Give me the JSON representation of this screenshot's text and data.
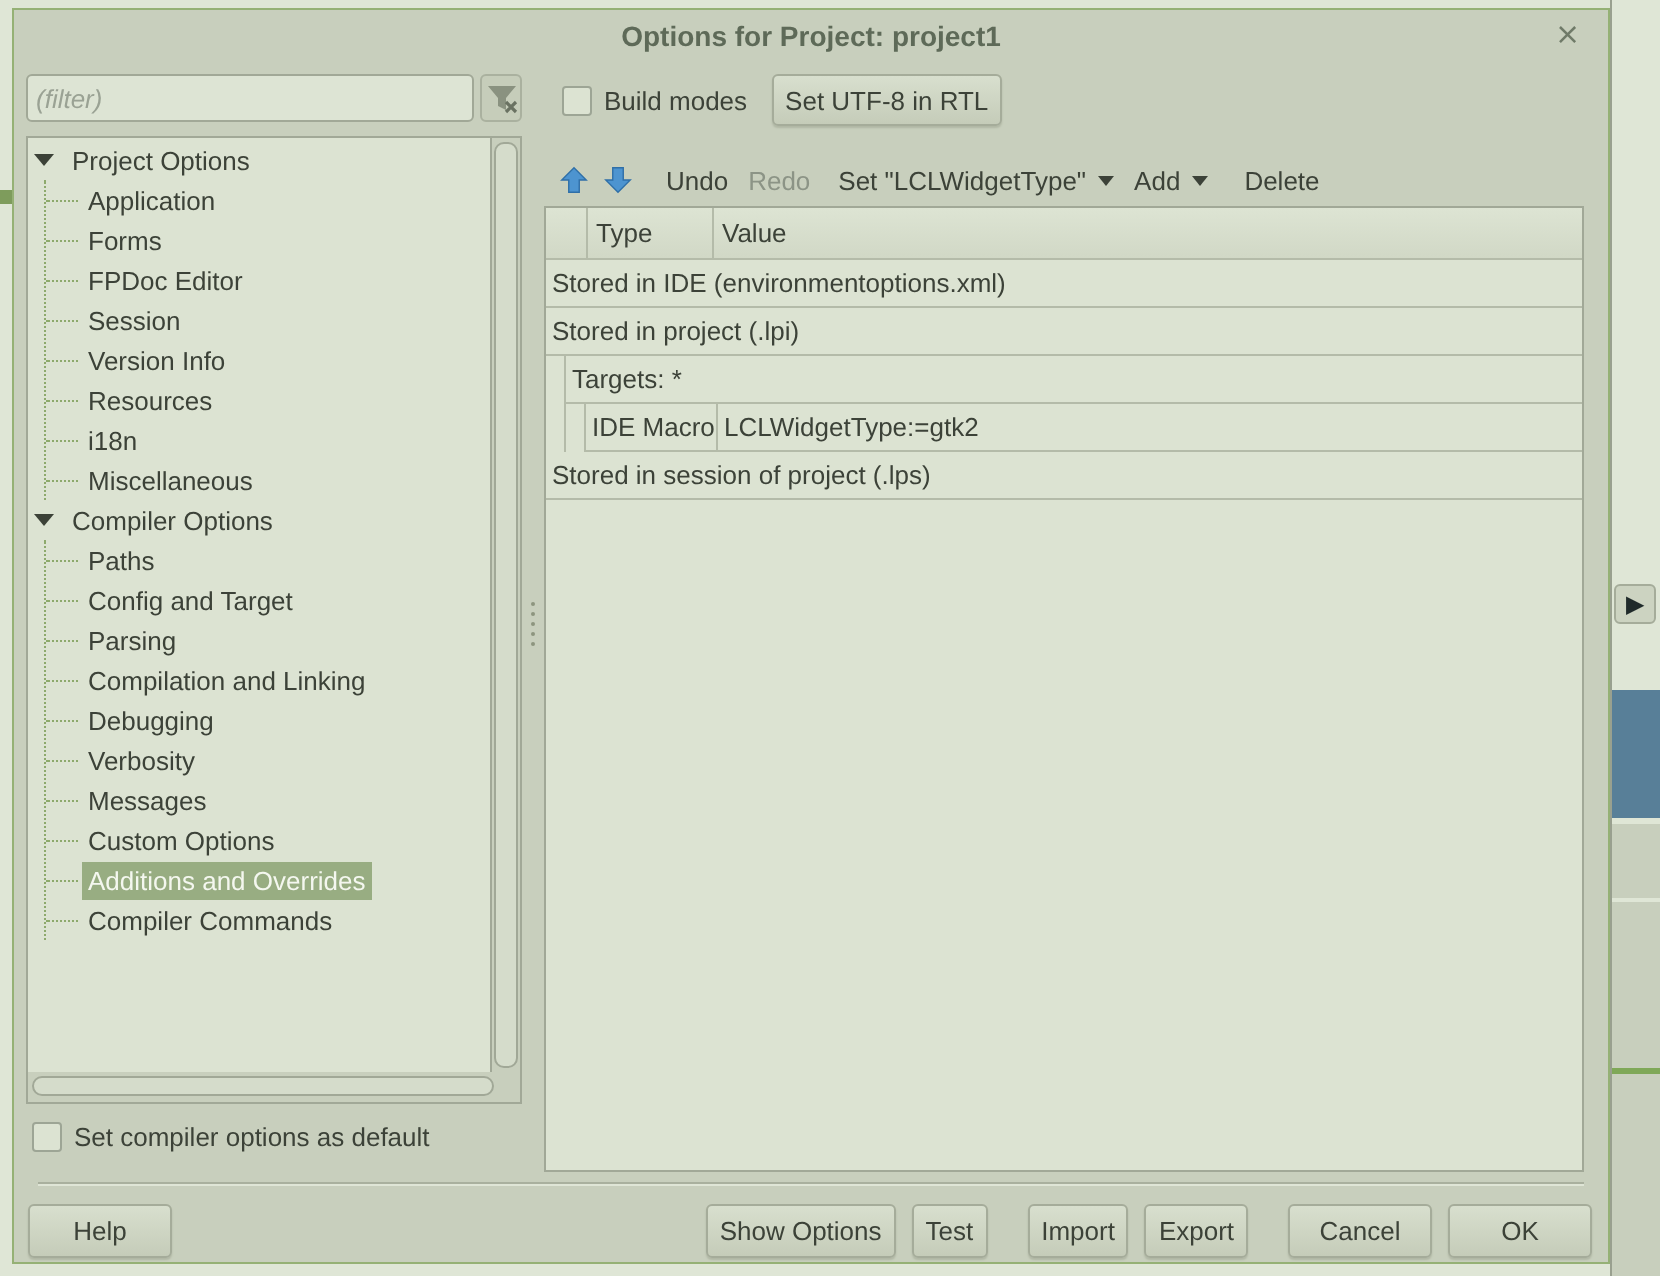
{
  "window": {
    "title": "Options for Project: project1",
    "close": "×"
  },
  "filter": {
    "placeholder": "(filter)"
  },
  "tree": [
    {
      "label": "Project Options",
      "expanded": true,
      "selected": false,
      "children": [
        {
          "label": "Application",
          "selected": false
        },
        {
          "label": "Forms",
          "selected": false
        },
        {
          "label": "FPDoc Editor",
          "selected": false
        },
        {
          "label": "Session",
          "selected": false
        },
        {
          "label": "Version Info",
          "selected": false
        },
        {
          "label": "Resources",
          "selected": false
        },
        {
          "label": "i18n",
          "selected": false
        },
        {
          "label": "Miscellaneous",
          "selected": false
        }
      ]
    },
    {
      "label": "Compiler Options",
      "expanded": true,
      "selected": false,
      "children": [
        {
          "label": "Paths",
          "selected": false
        },
        {
          "label": "Config and Target",
          "selected": false
        },
        {
          "label": "Parsing",
          "selected": false
        },
        {
          "label": "Compilation and Linking",
          "selected": false
        },
        {
          "label": "Debugging",
          "selected": false
        },
        {
          "label": "Verbosity",
          "selected": false
        },
        {
          "label": "Messages",
          "selected": false
        },
        {
          "label": "Custom Options",
          "selected": false
        },
        {
          "label": "Additions and Overrides",
          "selected": true
        },
        {
          "label": "Compiler Commands",
          "selected": false
        }
      ]
    }
  ],
  "default_checkbox": {
    "label": "Set compiler options as default",
    "checked": false
  },
  "build_modes": {
    "label": "Build modes",
    "checked": false
  },
  "rtl_button": "Set UTF-8 in RTL",
  "toolbar": [
    {
      "kind": "up",
      "disabled": false
    },
    {
      "kind": "down",
      "disabled": false
    },
    {
      "kind": "text",
      "label": "Undo",
      "disabled": false
    },
    {
      "kind": "text",
      "label": "Redo",
      "disabled": true
    },
    {
      "kind": "dropdown",
      "label": "Set \"LCLWidgetType\"",
      "disabled": false
    },
    {
      "kind": "dropdown",
      "label": "Add",
      "disabled": false
    },
    {
      "kind": "text",
      "label": "Delete",
      "disabled": false
    }
  ],
  "grid": {
    "columns": [
      "Type",
      "Value"
    ],
    "rows": [
      {
        "kind": "group",
        "text": "Stored in IDE (environmentoptions.xml)"
      },
      {
        "kind": "group",
        "text": "Stored in project (.lpi)",
        "children": [
          {
            "kind": "group",
            "text": "Targets: *",
            "children": [
              {
                "kind": "entry",
                "type": "IDE Macro",
                "value": "LCLWidgetType:=gtk2"
              }
            ]
          }
        ]
      },
      {
        "kind": "group",
        "text": "Stored in session of project (.lps)"
      }
    ]
  },
  "side_button": "▶",
  "buttons": [
    "Help",
    "Show Options",
    "Test",
    "Import",
    "Export",
    "Cancel",
    "OK"
  ]
}
